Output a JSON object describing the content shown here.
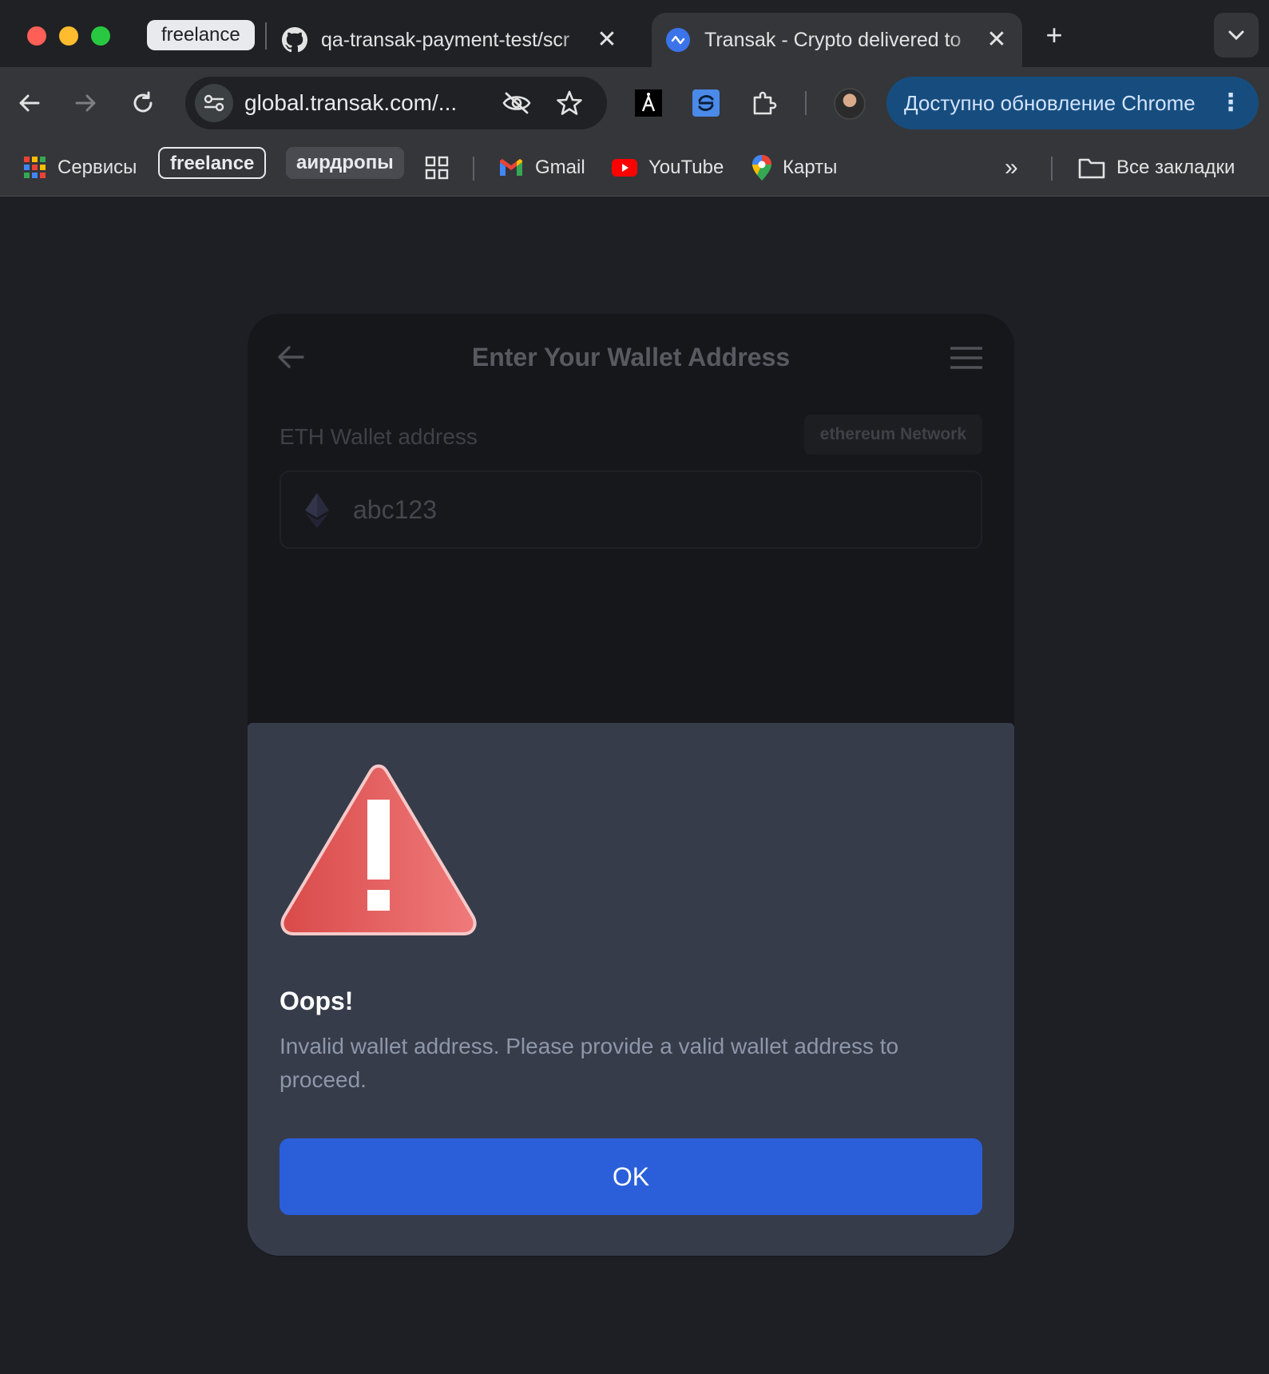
{
  "browser": {
    "tab_group": "freelance",
    "tabs": [
      {
        "title": "qa-transak-payment-test/scr",
        "favicon": "github-icon"
      },
      {
        "title": "Transak - Crypto delivered to",
        "favicon": "transak-icon",
        "active": true
      }
    ],
    "url": "global.transak.com/...",
    "update_button": "Доступно обновление Chrome",
    "bookmarks": {
      "apps": "Сервисы",
      "group1": "freelance",
      "group2": "аирдропы",
      "gmail": "Gmail",
      "youtube": "YouTube",
      "maps": "Карты",
      "all_bookmarks": "Все закладки"
    }
  },
  "widget": {
    "title": "Enter Your Wallet Address",
    "field_label": "ETH Wallet address",
    "network_badge": "ethereum Network",
    "address_value": "abc123"
  },
  "modal": {
    "title": "Oops!",
    "message": "Invalid wallet address. Please provide a valid wallet address to proceed.",
    "ok_label": "OK"
  },
  "colors": {
    "accent": "#2b5fd9",
    "modal_bg": "#363c4a",
    "warning": "#e05555",
    "update_btn": "#164d7e"
  }
}
